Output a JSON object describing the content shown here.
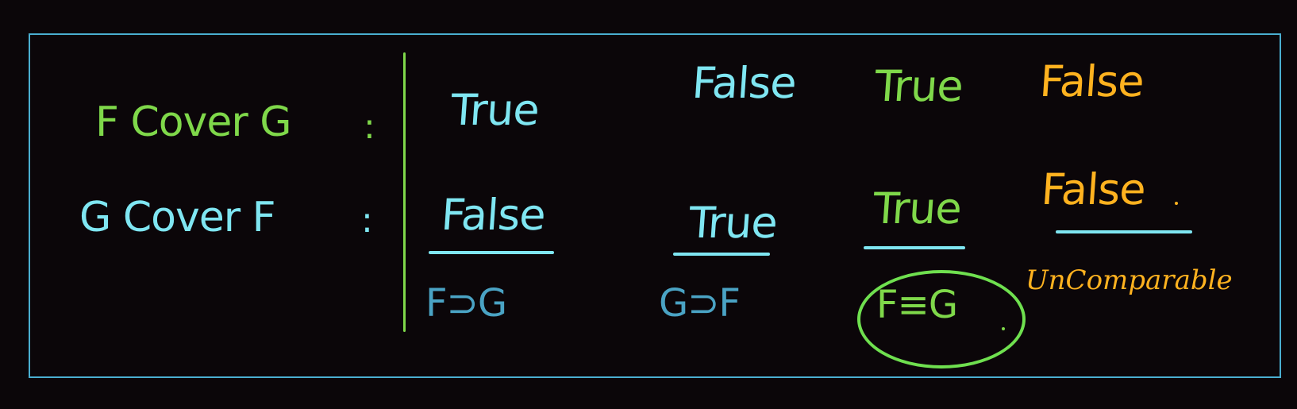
{
  "colors": {
    "green": "#7fd84a",
    "cyan": "#7fe6f2",
    "teal": "#4aa3c4",
    "orange": "#ffb21f",
    "frame": "#4aaed0"
  },
  "rows": {
    "f_cover_g": {
      "label": "F Cover G",
      "colon": ":",
      "values": [
        "True",
        "False",
        "True",
        "False"
      ]
    },
    "g_cover_f": {
      "label": "G Cover F",
      "colon": ":",
      "values": [
        "False",
        "True",
        "True",
        "False"
      ]
    }
  },
  "conclusions": {
    "c1": "F⊃G",
    "c2": "G⊃F",
    "c3": "F≡G",
    "c4": "UnComparable"
  }
}
